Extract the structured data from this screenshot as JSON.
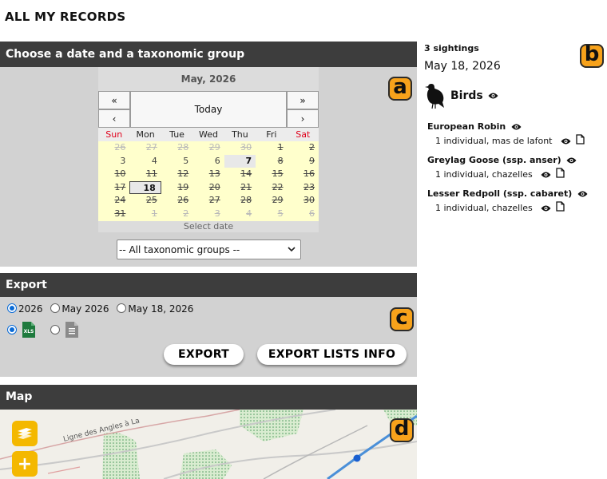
{
  "page": {
    "title": "ALL MY RECORDS"
  },
  "badges": {
    "a": "a",
    "b": "b",
    "c": "c",
    "d": "d"
  },
  "calendar_panel": {
    "heading": "Choose a date and a taxonomic group",
    "calendar": {
      "month_label": "May, 2026",
      "prev_year": "«",
      "prev_month": "‹",
      "next_year": "»",
      "next_month": "›",
      "today_label": "Today",
      "weekdays": [
        "Sun",
        "Mon",
        "Tue",
        "Wed",
        "Thu",
        "Fri",
        "Sat"
      ],
      "weeks": [
        [
          {
            "d": "26",
            "s": "om"
          },
          {
            "d": "27",
            "s": "om"
          },
          {
            "d": "28",
            "s": "om"
          },
          {
            "d": "29",
            "s": "om"
          },
          {
            "d": "30",
            "s": "om"
          },
          {
            "d": "1",
            "s": ""
          },
          {
            "d": "2",
            "s": ""
          }
        ],
        [
          {
            "d": "3",
            "s": "n"
          },
          {
            "d": "4",
            "s": "n"
          },
          {
            "d": "5",
            "s": "n"
          },
          {
            "d": "6",
            "s": "n"
          },
          {
            "d": "7",
            "s": "avail"
          },
          {
            "d": "8",
            "s": ""
          },
          {
            "d": "9",
            "s": ""
          }
        ],
        [
          {
            "d": "10",
            "s": ""
          },
          {
            "d": "11",
            "s": ""
          },
          {
            "d": "12",
            "s": ""
          },
          {
            "d": "13",
            "s": ""
          },
          {
            "d": "14",
            "s": ""
          },
          {
            "d": "15",
            "s": ""
          },
          {
            "d": "16",
            "s": ""
          }
        ],
        [
          {
            "d": "17",
            "s": ""
          },
          {
            "d": "18",
            "s": "sel"
          },
          {
            "d": "19",
            "s": ""
          },
          {
            "d": "20",
            "s": ""
          },
          {
            "d": "21",
            "s": ""
          },
          {
            "d": "22",
            "s": ""
          },
          {
            "d": "23",
            "s": ""
          }
        ],
        [
          {
            "d": "24",
            "s": ""
          },
          {
            "d": "25",
            "s": ""
          },
          {
            "d": "26",
            "s": ""
          },
          {
            "d": "27",
            "s": ""
          },
          {
            "d": "28",
            "s": ""
          },
          {
            "d": "29",
            "s": ""
          },
          {
            "d": "30",
            "s": ""
          }
        ],
        [
          {
            "d": "31",
            "s": ""
          },
          {
            "d": "1",
            "s": "om"
          },
          {
            "d": "2",
            "s": "om"
          },
          {
            "d": "3",
            "s": "om"
          },
          {
            "d": "4",
            "s": "om"
          },
          {
            "d": "5",
            "s": "om"
          },
          {
            "d": "6",
            "s": "om"
          }
        ]
      ],
      "footer": "Select date"
    },
    "taxonomic_select": {
      "value": "-- All taxonomic groups --"
    }
  },
  "export_panel": {
    "heading": "Export",
    "period_options": [
      {
        "label": "2026",
        "selected": true
      },
      {
        "label": "May 2026",
        "selected": false
      },
      {
        "label": "May 18, 2026",
        "selected": false
      }
    ],
    "format_options": [
      {
        "icon": "xls-file-icon",
        "label": "XLS",
        "selected": true
      },
      {
        "icon": "text-file-icon",
        "label": "",
        "selected": false
      }
    ],
    "export_button": "EXPORT",
    "export_lists_button": "EXPORT LISTS INFO"
  },
  "map_panel": {
    "heading": "Map",
    "road_label": "Ligne des Angles à La",
    "layers_icon": "layers-icon",
    "zoom_in_label": "+"
  },
  "sidebar": {
    "count": "3 sightings",
    "date": "May 18, 2026",
    "group": {
      "name": "Birds",
      "icon": "bird-icon"
    },
    "records": [
      {
        "species": "European Robin",
        "detail": "1 individual, mas de lafont"
      },
      {
        "species": "Greylag Goose (ssp. anser)",
        "detail": "1 individual, chazelles"
      },
      {
        "species": "Lesser Redpoll (ssp. cabaret)",
        "detail": "1 individual, chazelles"
      }
    ]
  },
  "colors": {
    "accent": "#f7a21b",
    "panel_header": "#3d3d3d",
    "panel_body": "#d2d2d2",
    "calendar_bg": "#ffffcc",
    "weekend": "#e0001b",
    "map_button": "#f4b800"
  }
}
